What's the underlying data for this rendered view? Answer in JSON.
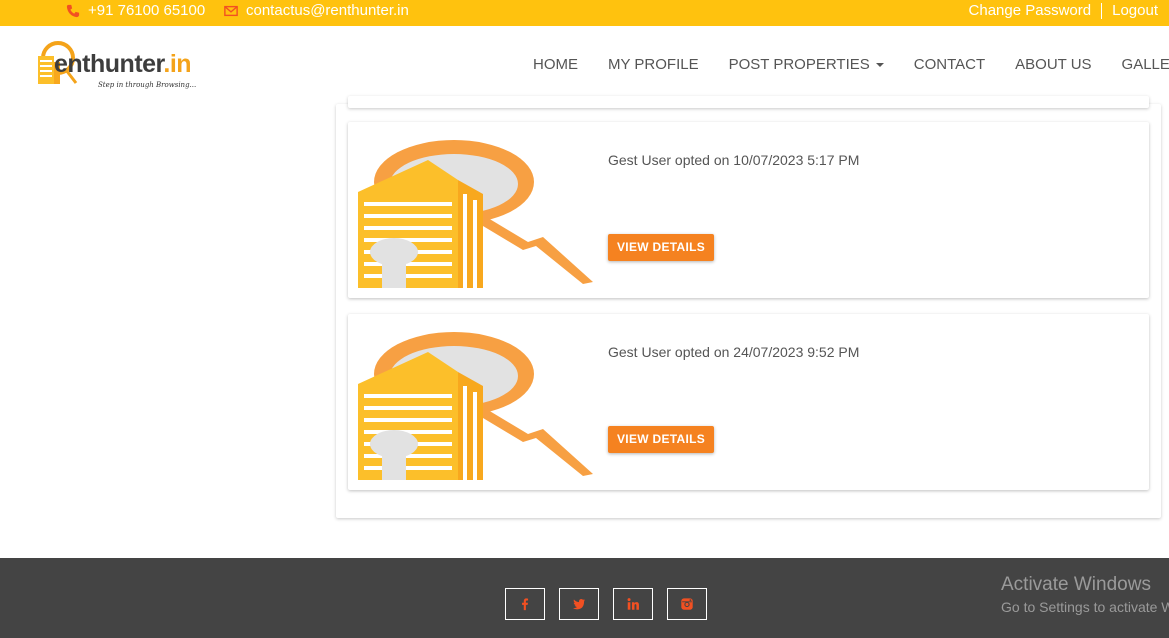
{
  "topbar": {
    "phone": "+91 76100 65100",
    "email": "contactus@renthunter.in",
    "change_password": "Change Password",
    "logout": "Logout"
  },
  "logo": {
    "brand_main": "enthunter",
    "brand_tld": ".in",
    "tagline": "Step in through Browsing..."
  },
  "nav": {
    "items": [
      "HOME",
      "MY PROFILE",
      "POST PROPERTIES",
      "CONTACT",
      "ABOUT US",
      "GALLERY"
    ]
  },
  "cards": [
    {
      "opted_text": "Gest User opted on 10/07/2023 5:17 PM",
      "button": "VIEW DETAILS"
    },
    {
      "opted_text": "Gest User opted on 24/07/2023 9:52 PM",
      "button": "VIEW DETAILS"
    }
  ],
  "footer": {
    "social": [
      "facebook-icon",
      "twitter-icon",
      "linkedin-icon",
      "instagram-icon"
    ]
  },
  "watermark": {
    "title": "Activate Windows",
    "subtitle": "Go to Settings to activate Windows."
  },
  "colors": {
    "topbar": "#ffc20e",
    "accent": "#f58220",
    "footer": "#444444",
    "icon_red": "#f25022"
  }
}
